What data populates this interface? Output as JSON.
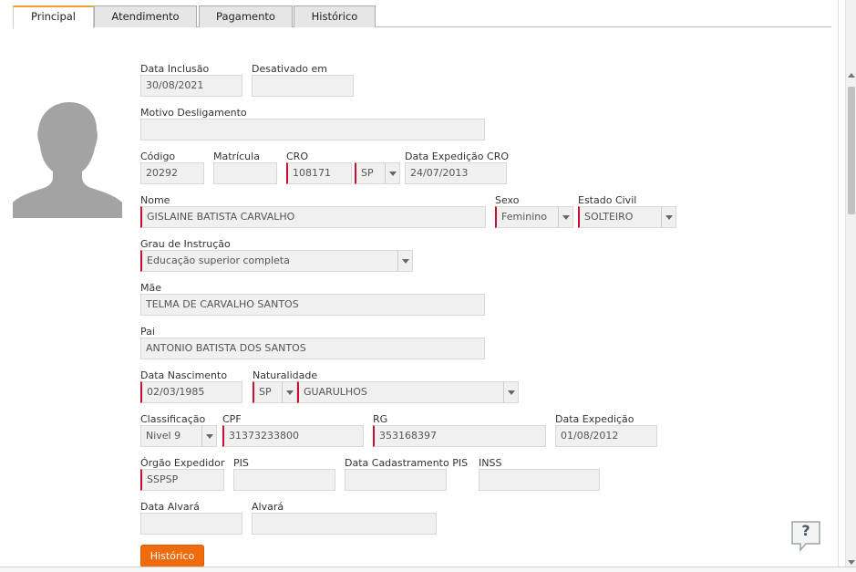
{
  "tabs": [
    "Principal",
    "Atendimento",
    "Pagamento",
    "Histórico"
  ],
  "form": {
    "data_inclusao": {
      "label": "Data Inclusão",
      "value": "30/08/2021"
    },
    "desativado_em": {
      "label": "Desativado em",
      "value": ""
    },
    "motivo_desligamento": {
      "label": "Motivo Desligamento",
      "value": ""
    },
    "codigo": {
      "label": "Código",
      "value": "20292"
    },
    "matricula": {
      "label": "Matrícula",
      "value": ""
    },
    "cro": {
      "label": "CRO",
      "value": "108171",
      "uf": "SP"
    },
    "data_expedicao_cro": {
      "label": "Data Expedição CRO",
      "value": "24/07/2013"
    },
    "nome": {
      "label": "Nome",
      "value": "GISLAINE BATISTA CARVALHO"
    },
    "sexo": {
      "label": "Sexo",
      "value": "Feminino"
    },
    "estado_civil": {
      "label": "Estado Civil",
      "value": "SOLTEIRO"
    },
    "grau_instrucao": {
      "label": "Grau de Instrução",
      "value": "Educação superior completa"
    },
    "mae": {
      "label": "Mãe",
      "value": "TELMA DE CARVALHO SANTOS"
    },
    "pai": {
      "label": "Pai",
      "value": "ANTONIO BATISTA DOS SANTOS"
    },
    "data_nascimento": {
      "label": "Data Nascimento",
      "value": "02/03/1985"
    },
    "naturalidade": {
      "label": "Naturalidade",
      "uf": "SP",
      "city": "GUARULHOS"
    },
    "classificacao": {
      "label": "Classificação",
      "value": "Nivel 9"
    },
    "cpf": {
      "label": "CPF",
      "value": "31373233800"
    },
    "rg": {
      "label": "RG",
      "value": "353168397"
    },
    "data_expedicao": {
      "label": "Data Expedição",
      "value": "01/08/2012"
    },
    "orgao_expedidor": {
      "label": "Órgão Expedidor",
      "value": "SSPSP"
    },
    "pis": {
      "label": "PIS",
      "value": ""
    },
    "data_cadastramento_pis": {
      "label": "Data Cadastramento PIS",
      "value": ""
    },
    "inss": {
      "label": "INSS",
      "value": ""
    },
    "data_alvara": {
      "label": "Data Alvará",
      "value": ""
    },
    "alvara": {
      "label": "Alvará",
      "value": ""
    }
  },
  "buttons": {
    "historico": "Histórico",
    "help": "?"
  },
  "colors": {
    "accent": "#f06a0e",
    "required": "#c8102e",
    "tab_active": "#f0a030"
  }
}
